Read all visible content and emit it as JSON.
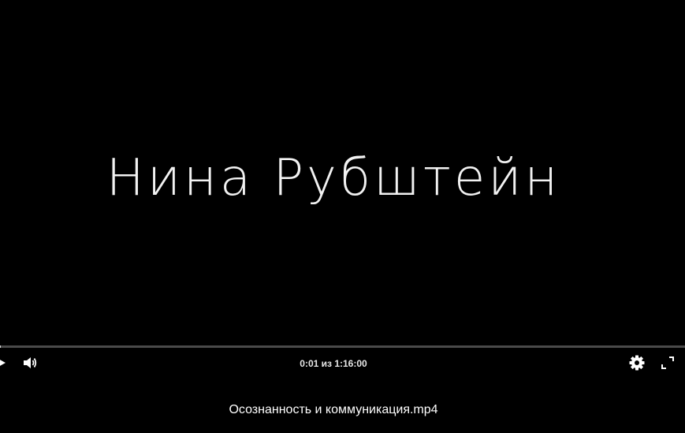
{
  "video": {
    "title_text": "Нина Рубштейн"
  },
  "controls": {
    "time_current": "0:01",
    "time_separator": "из",
    "time_total": "1:16:00",
    "time_label": "0:01 из 1:16:00",
    "progress_fraction": 0.0002
  },
  "file": {
    "name": "Осознанность и коммуникация.mp4"
  },
  "icons": {
    "play": "play-icon",
    "volume": "volume-icon",
    "settings": "gear-icon",
    "fullscreen": "fullscreen-icon",
    "more": "more-vertical-icon"
  },
  "colors": {
    "background": "#000000",
    "text": "#ffffff",
    "progress_track": "#4a4a4a"
  }
}
